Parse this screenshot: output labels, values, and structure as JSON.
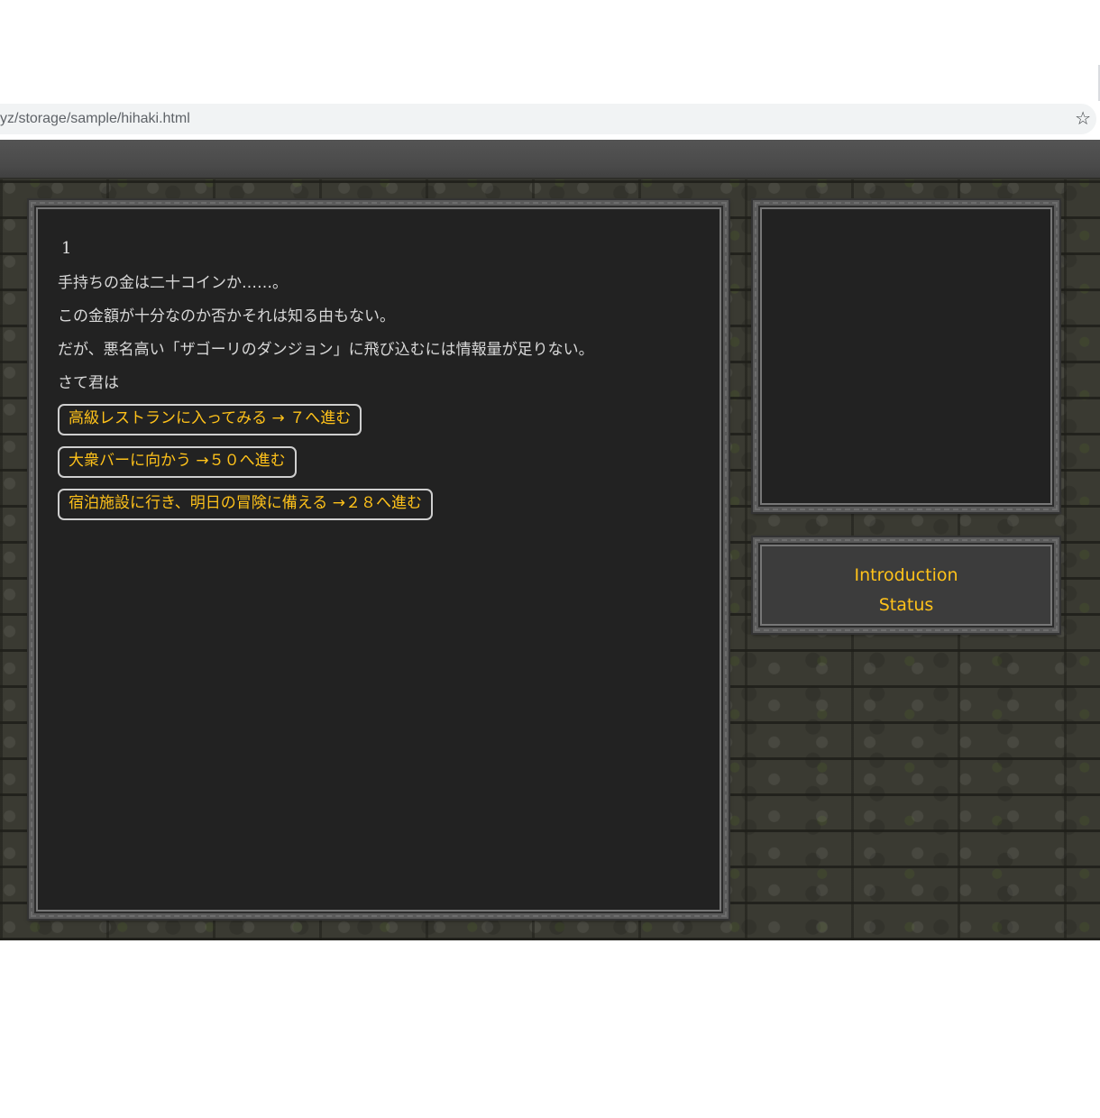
{
  "browser": {
    "url": "yz/storage/sample/hihaki.html",
    "bookmark_icon": "☆"
  },
  "story": {
    "paragraph_number": "1",
    "lines": [
      "手持ちの金は二十コインか……。",
      "この金額が十分なのか否かそれは知る由もない。",
      "だが、悪名高い「ザゴーリのダンジョン」に飛び込むには情報量が足りない。",
      "さて君は"
    ],
    "choices": [
      "高級レストランに入ってみる → ７へ進む",
      "大衆バーに向かう →５０へ進む",
      "宿泊施設に行き、明日の冒険に備える →２８へ進む"
    ]
  },
  "menu": {
    "items": [
      "Introduction",
      "Status"
    ]
  },
  "colors": {
    "accent": "#ffc21a",
    "panel": "#222222",
    "text": "#d8d8d8"
  }
}
